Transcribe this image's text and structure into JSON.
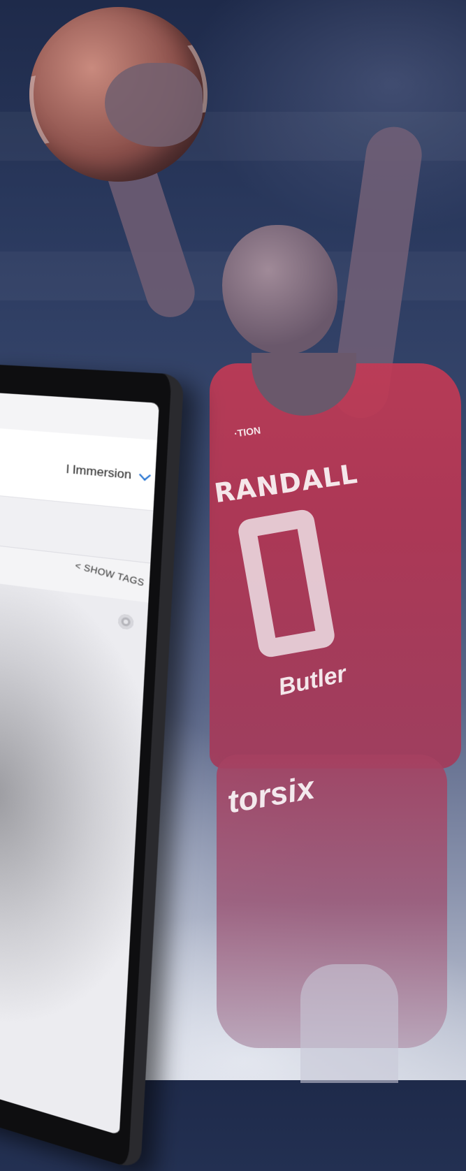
{
  "tablet": {
    "dropdown_value": "l Immersion",
    "show_tags_label": "< SHOW TAGS"
  },
  "jersey": {
    "sponsor_top": "·TION",
    "name": "RANDALL",
    "sponsor_mid": "Butler",
    "sponsor_bottom": "torsix"
  },
  "colors": {
    "background_top": "#1e2a4a",
    "jersey_red": "#c23a55",
    "accent_blue": "#1f6fd0"
  }
}
